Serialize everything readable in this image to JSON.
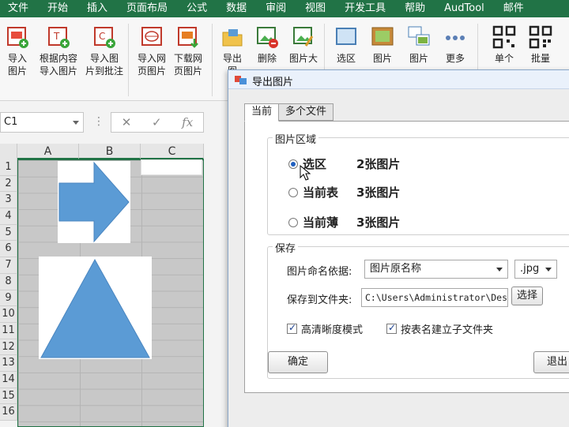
{
  "ribbon_tabs": [
    "文件",
    "开始",
    "插入",
    "页面布局",
    "公式",
    "数据",
    "审阅",
    "视图",
    "开发工具",
    "帮助",
    "AudTool",
    "邮件"
  ],
  "ribbon_buttons": {
    "insert_image": [
      "导入",
      "图片"
    ],
    "import_by_content": [
      "根据内容",
      "导入图片"
    ],
    "import_to_comment": [
      "导入图",
      "片到批注"
    ],
    "import_web_image": [
      "导入网",
      "页图片"
    ],
    "download_web_image": [
      "下载网",
      "页图片"
    ],
    "export": [
      "导出",
      "图"
    ],
    "delete": [
      "删除",
      ""
    ],
    "image_size": [
      "图片大",
      ""
    ],
    "select_area": [
      "选区",
      ""
    ],
    "image": [
      "图片",
      ""
    ],
    "image2": [
      "图片",
      ""
    ],
    "more": [
      "更多",
      ""
    ],
    "single": [
      "单个",
      ""
    ],
    "batch": [
      "批量",
      ""
    ]
  },
  "formula_bar": {
    "name_box": "C1",
    "cancel": "✕",
    "confirm": "✓",
    "fx": "fx"
  },
  "grid": {
    "columns": [
      "A",
      "B",
      "C"
    ],
    "rows": [
      "1",
      "2",
      "3",
      "4",
      "5",
      "6",
      "7",
      "8",
      "9",
      "10",
      "11",
      "12",
      "13",
      "14",
      "15",
      "16"
    ]
  },
  "dialog": {
    "title": "导出图片",
    "tabs": [
      "当前",
      "多个文件"
    ],
    "region_group": "图片区域",
    "options": [
      {
        "label": "选区",
        "count": "2张图片",
        "selected": true
      },
      {
        "label": "当前表",
        "count": "3张图片",
        "selected": false
      },
      {
        "label": "当前薄",
        "count": "3张图片",
        "selected": false
      }
    ],
    "save_group": "保存",
    "naming_label": "图片命名依据:",
    "naming_value": "图片原名称",
    "format_value": ".jpg",
    "folder_label": "保存到文件夹:",
    "folder_value": "C:\\Users\\Administrator\\Deskt",
    "browse_button": "选择",
    "hd_mode": "高清晰度模式",
    "subfolder": "按表名建立子文件夹",
    "ok_button": "确定",
    "exit_button": "退出"
  },
  "colors": {
    "accent": "#217346",
    "shape_blue": "#5b9bd5"
  }
}
